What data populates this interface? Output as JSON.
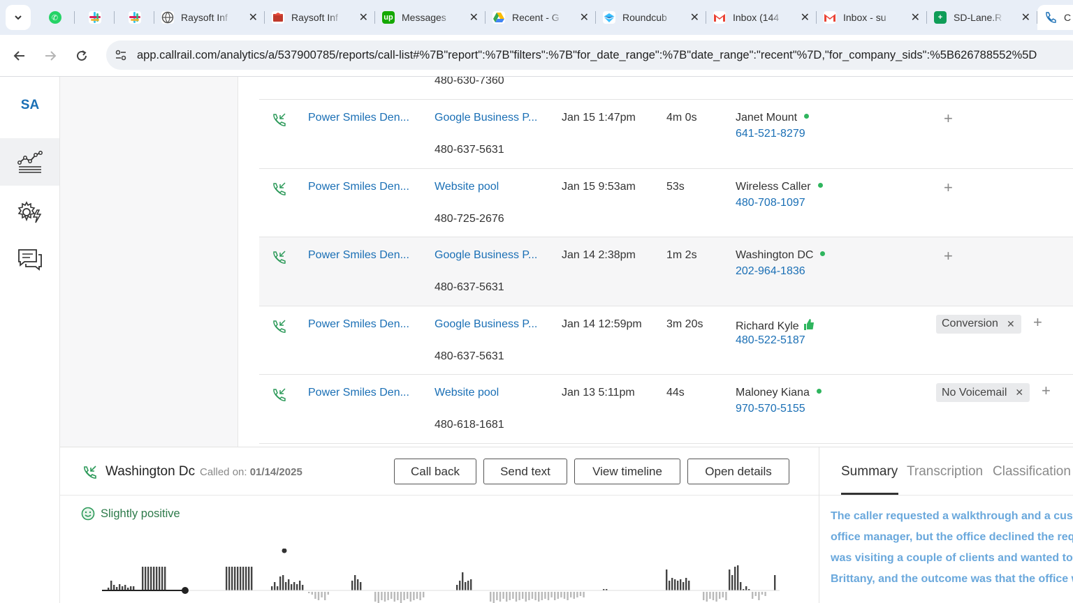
{
  "browser": {
    "tabs": [
      {
        "kind": "whatsapp",
        "label": ""
      },
      {
        "kind": "slack",
        "label": ""
      },
      {
        "kind": "slack",
        "label": ""
      },
      {
        "kind": "globe",
        "label": "Raysoft Inf",
        "close": "✕"
      },
      {
        "kind": "raysoft",
        "label": "Raysoft Inf",
        "close": "✕"
      },
      {
        "kind": "upwork",
        "label": "Messages",
        "close": "✕"
      },
      {
        "kind": "drive",
        "label": "Recent - G",
        "close": "✕"
      },
      {
        "kind": "roundcube",
        "label": "Roundcub",
        "close": "✕"
      },
      {
        "kind": "gmail",
        "label": "Inbox (144",
        "close": "✕"
      },
      {
        "kind": "gmail",
        "label": "Inbox - su",
        "close": "✕"
      },
      {
        "kind": "sheets",
        "label": "SD-Lane.R",
        "close": "✕"
      },
      {
        "kind": "callrail",
        "label": "C",
        "close": ""
      }
    ],
    "url": "app.callrail.com/analytics/a/537900785/reports/call-list#%7B\"report\":%7B\"filters\":%7B\"for_date_range\":%7B\"date_range\":\"recent\"%7D,\"for_company_sids\":%5B626788552%5D"
  },
  "sidebar": {
    "logo": "SA",
    "items": [
      {
        "name": "analytics",
        "icon": "chart-line-icon",
        "active": true
      },
      {
        "name": "settings",
        "icon": "gear-bolt-icon",
        "active": false
      },
      {
        "name": "conversations",
        "icon": "chat-bubbles-icon",
        "active": false
      }
    ]
  },
  "calls": {
    "partial_number": "480-630-7360",
    "rows": [
      {
        "company": "Power Smiles Den...",
        "source": "Google Business P...",
        "number": "480-637-5631",
        "datetime": "Jan 15 1:47pm",
        "duration": "4m 0s",
        "caller": "Janet Mount",
        "phone": "641-521-8279",
        "indicator": "dot",
        "tag": "",
        "plus": "+"
      },
      {
        "company": "Power Smiles Den...",
        "source": "Website pool",
        "number": "480-725-2676",
        "datetime": "Jan 15 9:53am",
        "duration": "53s",
        "caller": "Wireless Caller",
        "phone": "480-708-1097",
        "indicator": "dot",
        "tag": "",
        "plus": "+"
      },
      {
        "company": "Power Smiles Den...",
        "source": "Google Business P...",
        "number": "480-637-5631",
        "datetime": "Jan 14 2:38pm",
        "duration": "1m 2s",
        "caller": "Washington DC",
        "phone": "202-964-1836",
        "indicator": "dot",
        "tag": "",
        "plus": "+"
      },
      {
        "company": "Power Smiles Den...",
        "source": "Google Business P...",
        "number": "480-637-5631",
        "datetime": "Jan 14 12:59pm",
        "duration": "3m 20s",
        "caller": "Richard Kyle",
        "phone": "480-522-5187",
        "indicator": "thumbs-up-icon",
        "tag": "Conversion",
        "plus": "+"
      },
      {
        "company": "Power Smiles Den...",
        "source": "Website pool",
        "number": "480-618-1681",
        "datetime": "Jan 13 5:11pm",
        "duration": "44s",
        "caller": "Maloney Kiana",
        "phone": "970-570-5155",
        "indicator": "dot",
        "tag": "No Voicemail",
        "plus": "+"
      }
    ]
  },
  "detail": {
    "caller": "Washington Dc",
    "called_on_label": "Called on:",
    "called_on_date": "01/14/2025",
    "buttons": {
      "call_back": "Call back",
      "send_text": "Send text",
      "view_timeline": "View timeline",
      "open_details": "Open details"
    },
    "sentiment": "Slightly positive",
    "tabs": {
      "summary": "Summary",
      "transcription": "Transcription",
      "classification": "Classification"
    },
    "summary_lines": [
      "The caller requested a walkthrough and a custo",
      "office manager, but the office declined the requ",
      "was visiting a couple of clients and wanted to p",
      "Brittany, and the outcome was that the office w"
    ],
    "tag_remove": "✕",
    "colors": {
      "link": "#1a6fb5",
      "sentiment": "#2d7a4a",
      "dot": "#2fb55e",
      "summary": "#6aa8dc"
    }
  }
}
